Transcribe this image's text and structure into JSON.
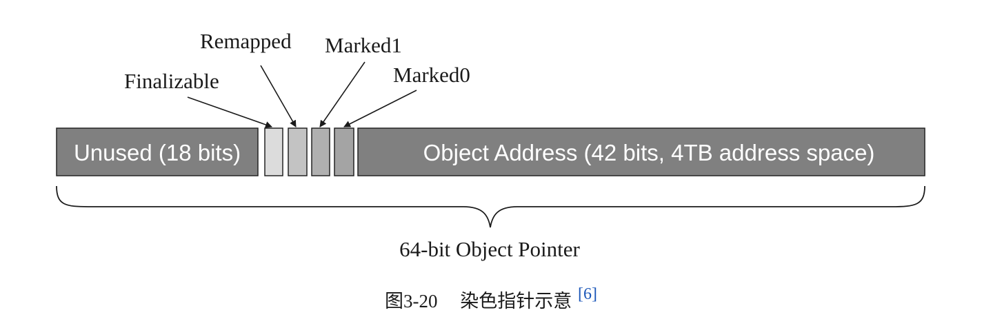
{
  "segments": {
    "unused": {
      "label": "Unused (18 bits)"
    },
    "address": {
      "label": "Object Address (42 bits, 4TB address space)"
    }
  },
  "flags": {
    "finalizable": "Finalizable",
    "remapped": "Remapped",
    "marked1": "Marked1",
    "marked0": "Marked0"
  },
  "brace_label": "64-bit Object Pointer",
  "caption": {
    "number": "图3-20",
    "text": "染色指针示意",
    "reference": "[6]"
  },
  "colors": {
    "segment_fill": "#808080",
    "segment_text": "#ffffff",
    "finalizable_fill": "#dcdcdc",
    "remapped_fill": "#c3c3c3",
    "marked1_fill": "#b0b0b0",
    "marked0_fill": "#a4a4a4",
    "caption_reference": "#1a56b8",
    "ink": "#1a1a1a"
  }
}
